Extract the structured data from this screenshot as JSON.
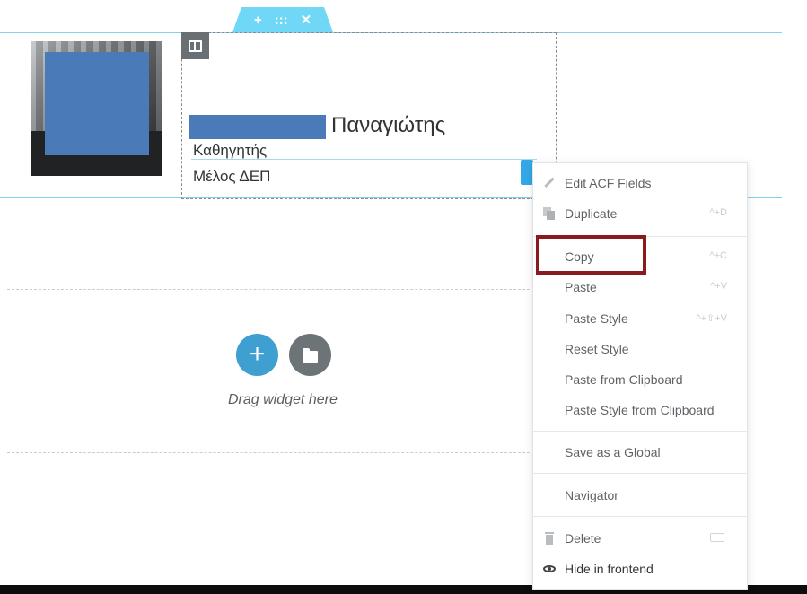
{
  "section_handle": {
    "add": "+",
    "move": ":::",
    "close": "✕"
  },
  "profile": {
    "surname": "Παναγιώτης",
    "title": "Καθηγητής",
    "role": "Μέλος ΔΕΠ"
  },
  "drop_zone": {
    "drag_text": "Drag widget here"
  },
  "context_menu": {
    "edit_acf": {
      "label": "Edit ACF Fields"
    },
    "duplicate": {
      "label": "Duplicate",
      "shortcut": "^+D"
    },
    "copy": {
      "label": "Copy",
      "shortcut": "^+C"
    },
    "paste": {
      "label": "Paste",
      "shortcut": "^+V"
    },
    "paste_style": {
      "label": "Paste Style",
      "shortcut": "^+⇧+V"
    },
    "reset_style": {
      "label": "Reset Style"
    },
    "paste_clipboard": {
      "label": "Paste from Clipboard"
    },
    "paste_style_clipboard": {
      "label": "Paste Style from Clipboard"
    },
    "save_global": {
      "label": "Save as a Global"
    },
    "navigator": {
      "label": "Navigator"
    },
    "delete": {
      "label": "Delete"
    },
    "hide_frontend": {
      "label": "Hide in frontend"
    }
  },
  "colors": {
    "accent": "#71d7f7",
    "highlight_border": "#8b1a1f",
    "redaction": "#4a7bb8"
  }
}
